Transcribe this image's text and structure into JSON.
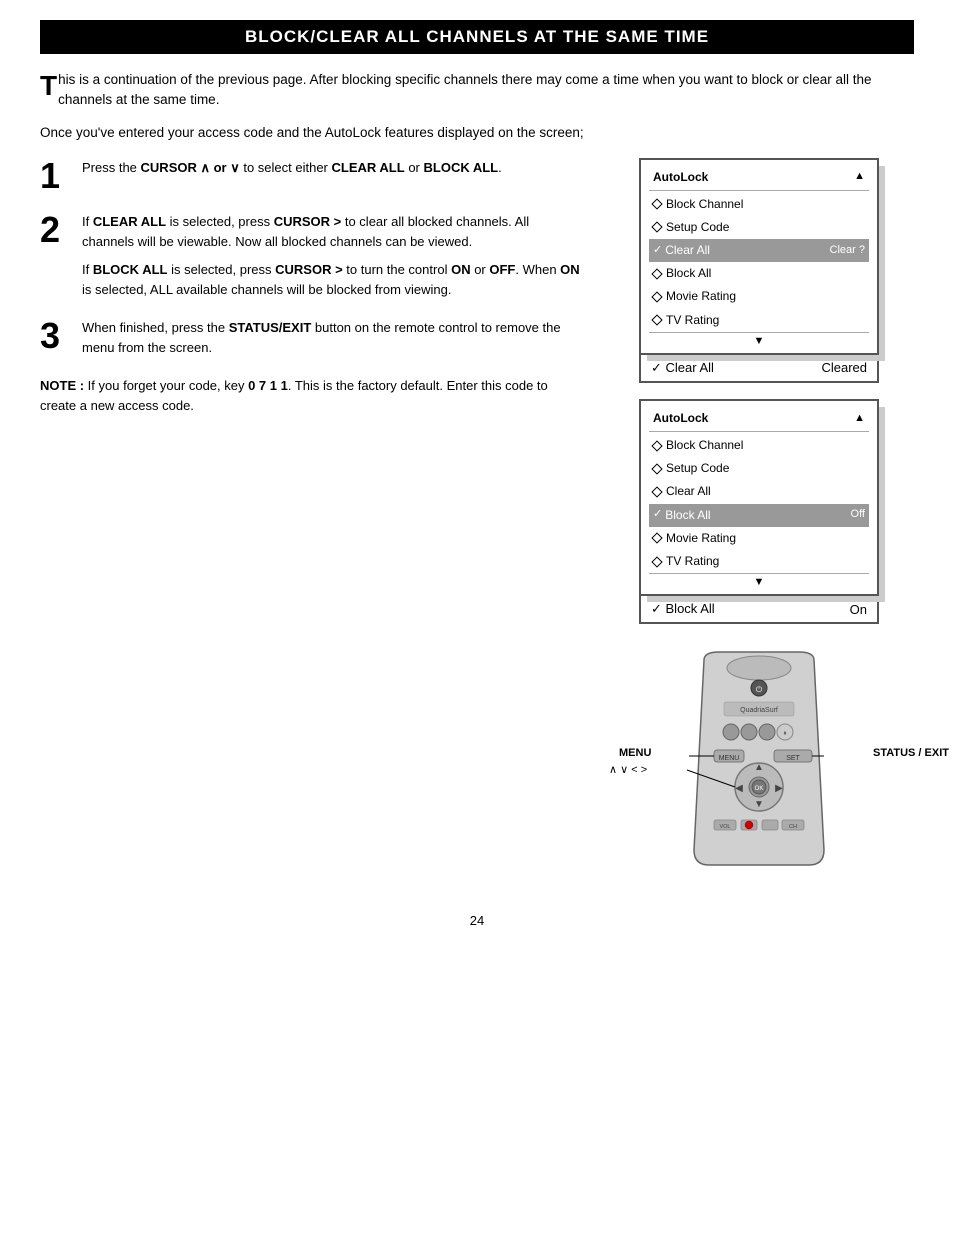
{
  "title": "BLOCK/CLEAR ALL CHANNELS AT THE SAME TIME",
  "intro": {
    "drop_cap": "T",
    "text": "his is a continuation of the previous page.  After blocking specific channels there may come a time when you want to block or clear all the channels at the same time."
  },
  "once_text": "Once you've entered your access code and the AutoLock features displayed on the screen;",
  "steps": [
    {
      "number": "1",
      "paragraphs": [
        "Press the CURSOR ∧ or ∨ to select either CLEAR ALL or BLOCK ALL."
      ]
    },
    {
      "number": "2",
      "paragraphs": [
        "If CLEAR ALL is selected, press CURSOR > to clear all blocked channels.  All channels will be viewable.  Now all blocked channels can be viewed.",
        "If BLOCK ALL is selected, press CURSOR > to turn the control ON or OFF.  When ON is selected, ALL available channels will be blocked from viewing."
      ]
    },
    {
      "number": "3",
      "paragraphs": [
        "When finished, press the STATUS/EXIT button on the remote control to remove the menu from the screen."
      ]
    }
  ],
  "note": "NOTE : If you forget your code, key 0 7 1 1. This is the factory default.  Enter this code to create a new access code.",
  "screens": [
    {
      "id": "screen1",
      "header": {
        "label": "AutoLock",
        "arrow": "▲"
      },
      "rows": [
        {
          "type": "diamond",
          "label": "Block Channel",
          "value": ""
        },
        {
          "type": "diamond",
          "label": "Setup Code",
          "value": ""
        },
        {
          "type": "check-selected",
          "label": "Clear All",
          "value": "Clear ?"
        },
        {
          "type": "diamond",
          "label": "Block All",
          "value": ""
        },
        {
          "type": "diamond",
          "label": "Movie Rating",
          "value": ""
        },
        {
          "type": "diamond",
          "label": "TV Rating",
          "value": ""
        }
      ],
      "footer_arrow": "▼"
    },
    {
      "id": "screen2",
      "header": {
        "label": "AutoLock",
        "arrow": "▲"
      },
      "rows": [
        {
          "type": "diamond",
          "label": "Block Channel",
          "value": ""
        },
        {
          "type": "diamond",
          "label": "Setup Code",
          "value": ""
        },
        {
          "type": "diamond",
          "label": "Clear All",
          "value": ""
        },
        {
          "type": "check-selected",
          "label": "Block All",
          "value": "Off"
        },
        {
          "type": "diamond",
          "label": "Movie Rating",
          "value": ""
        },
        {
          "type": "diamond",
          "label": "TV Rating",
          "value": ""
        }
      ],
      "footer_arrow": "▼"
    }
  ],
  "status_bars": [
    {
      "label": "✓ Clear All",
      "value": "Cleared"
    },
    {
      "label": "✓ Block All",
      "value": "On"
    }
  ],
  "remote_labels": {
    "menu": "MENU",
    "nav": "∧ ∨ < >",
    "status_exit": "STATUS / EXIT"
  },
  "page_number": "24"
}
